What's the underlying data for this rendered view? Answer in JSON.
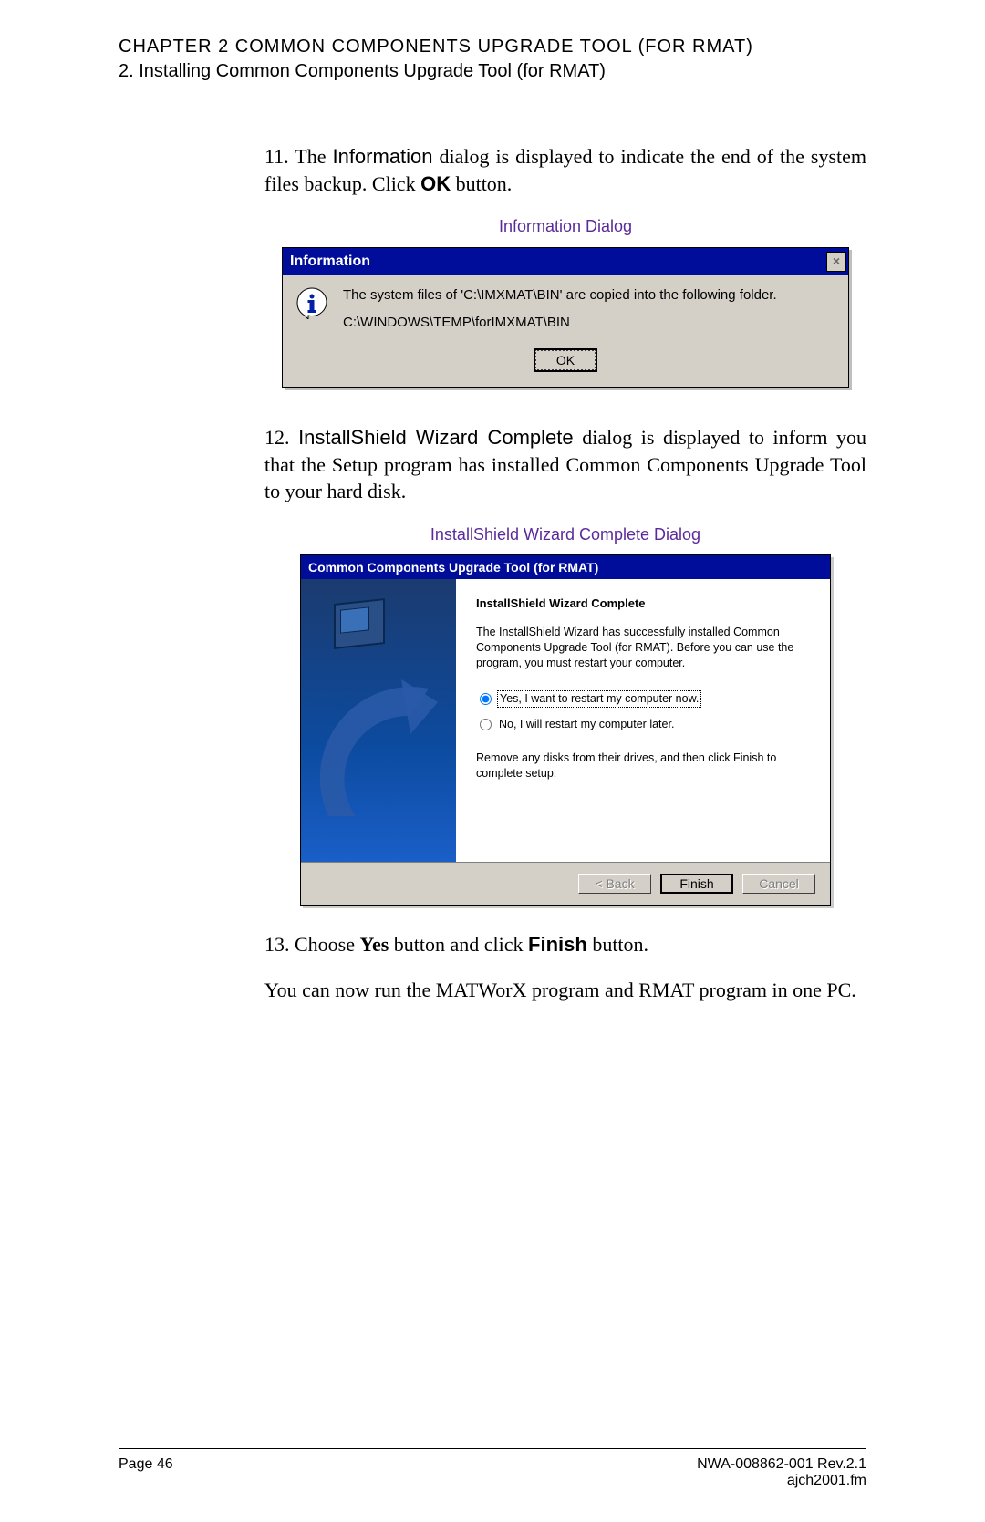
{
  "header": {
    "chapter": "CHAPTER 2 COMMON COMPONENTS UPGRADE TOOL (FOR RMAT)",
    "section": "2. Installing Common Components Upgrade Tool (for RMAT)"
  },
  "step11": {
    "num": "11.",
    "text_before_info": "The ",
    "info_word": "Information",
    "text_after_info": " dialog is displayed to indicate the end of the system files backup. Click ",
    "ok_word": "OK",
    "text_after_ok": " button."
  },
  "caption1": "Information Dialog",
  "info_dialog": {
    "title": "Information",
    "line1": "The system files of 'C:\\IMXMAT\\BIN' are copied into the following folder.",
    "line2": "C:\\WINDOWS\\TEMP\\forIMXMAT\\BIN",
    "ok": "OK"
  },
  "step12": {
    "num": "12.",
    "bold": "InstallShield Wizard Complete",
    "rest": " dialog is displayed to inform you that the Setup program has installed Common Components Upgrade Tool to your hard disk."
  },
  "caption2": "InstallShield Wizard Complete Dialog",
  "wizard": {
    "title": "Common Components Upgrade Tool (for RMAT)",
    "heading": "InstallShield Wizard Complete",
    "para1": "The InstallShield Wizard has successfully installed Common Components Upgrade Tool (for RMAT).  Before you can use the program, you must restart your computer.",
    "radio_yes": "Yes, I want to restart my computer now.",
    "radio_no": "No, I will restart my computer later.",
    "para2": "Remove any disks from their drives, and then click Finish to complete setup.",
    "back": "< Back",
    "finish": "Finish",
    "cancel": "Cancel"
  },
  "step13": {
    "num": "13.",
    "before_yes": "Choose ",
    "yes_word": "Yes",
    "mid": " button and click ",
    "finish_word": "Finish",
    "after": " button."
  },
  "closing": "You can now run the MATWorX program and RMAT program in one PC.",
  "footer": {
    "page": "Page 46",
    "doc": "NWA-008862-001 Rev.2.1",
    "file": "ajch2001.fm"
  }
}
